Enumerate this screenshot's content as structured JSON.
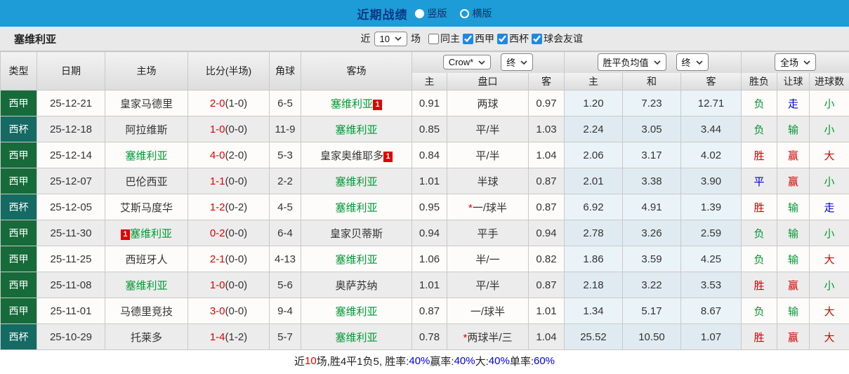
{
  "topbar": {
    "title": "近期战绩",
    "radio_vertical": "竖版",
    "radio_horizontal": "横版",
    "selected": "竖版",
    "bar_color": "#1e9cd7"
  },
  "filterbar": {
    "team": "塞维利亚",
    "near_label": "近",
    "near_value": "10",
    "games_label": "场",
    "checkboxes": [
      {
        "label": "同主",
        "checked": false
      },
      {
        "label": "西甲",
        "checked": true
      },
      {
        "label": "西杯",
        "checked": true
      },
      {
        "label": "球会友谊",
        "checked": true
      }
    ]
  },
  "table": {
    "col_headers": [
      "类型",
      "日期",
      "主场",
      "比分(半场)",
      "角球",
      "客场"
    ],
    "dropdowns": {
      "odds_source": "Crow*",
      "odds_final": "终",
      "avg_source": "胜平负均值",
      "avg_final": "终",
      "scope": "全场"
    },
    "subheaders": [
      "主",
      "盘口",
      "客",
      "主",
      "和",
      "客",
      "胜负",
      "让球",
      "进球数"
    ],
    "league_colors": {
      "西甲": "#176b3a",
      "西杯": "#156a63"
    },
    "rows": [
      {
        "league": "西甲",
        "type": "liga",
        "date": "25-12-21",
        "home": {
          "name": "皇家马德里",
          "green": false
        },
        "score": {
          "ft": "2-0",
          "ht": "(1-0)"
        },
        "corners": "6-5",
        "away": {
          "name": "塞维利亚",
          "green": true,
          "badge_after": "1"
        },
        "odds_home": "0.91",
        "handicap": {
          "star": false,
          "text": "两球"
        },
        "odds_away": "0.97",
        "avg_home": "1.20",
        "avg_draw": "7.23",
        "avg_away": "12.71",
        "result": {
          "t": "负",
          "c": "green"
        },
        "handicap_result": {
          "t": "走",
          "c": "blue"
        },
        "goals": {
          "t": "小",
          "c": "green"
        }
      },
      {
        "league": "西杯",
        "type": "cup",
        "date": "25-12-18",
        "home": {
          "name": "阿拉维斯",
          "green": false
        },
        "score": {
          "ft": "1-0",
          "ht": "(0-0)"
        },
        "corners": "11-9",
        "away": {
          "name": "塞维利亚",
          "green": true
        },
        "odds_home": "0.85",
        "handicap": {
          "star": false,
          "text": "平/半"
        },
        "odds_away": "1.03",
        "avg_home": "2.24",
        "avg_draw": "3.05",
        "avg_away": "3.44",
        "result": {
          "t": "负",
          "c": "green"
        },
        "handicap_result": {
          "t": "输",
          "c": "green"
        },
        "goals": {
          "t": "小",
          "c": "green"
        }
      },
      {
        "league": "西甲",
        "type": "liga",
        "date": "25-12-14",
        "home": {
          "name": "塞维利亚",
          "green": true
        },
        "score": {
          "ft": "4-0",
          "ht": "(2-0)"
        },
        "corners": "5-3",
        "away": {
          "name": "皇家奥维耶多",
          "green": false,
          "badge_after": "1"
        },
        "odds_home": "0.84",
        "handicap": {
          "star": false,
          "text": "平/半"
        },
        "odds_away": "1.04",
        "avg_home": "2.06",
        "avg_draw": "3.17",
        "avg_away": "4.02",
        "result": {
          "t": "胜",
          "c": "red"
        },
        "handicap_result": {
          "t": "赢",
          "c": "red"
        },
        "goals": {
          "t": "大",
          "c": "red"
        }
      },
      {
        "league": "西甲",
        "type": "liga",
        "date": "25-12-07",
        "home": {
          "name": "巴伦西亚",
          "green": false
        },
        "score": {
          "ft": "1-1",
          "ht": "(0-0)"
        },
        "corners": "2-2",
        "away": {
          "name": "塞维利亚",
          "green": true
        },
        "odds_home": "1.01",
        "handicap": {
          "star": false,
          "text": "半球"
        },
        "odds_away": "0.87",
        "avg_home": "2.01",
        "avg_draw": "3.38",
        "avg_away": "3.90",
        "result": {
          "t": "平",
          "c": "blue"
        },
        "handicap_result": {
          "t": "赢",
          "c": "red"
        },
        "goals": {
          "t": "小",
          "c": "green"
        }
      },
      {
        "league": "西杯",
        "type": "cup",
        "date": "25-12-05",
        "home": {
          "name": "艾斯马度华",
          "green": false
        },
        "score": {
          "ft": "1-2",
          "ht": "(0-2)"
        },
        "corners": "4-5",
        "away": {
          "name": "塞维利亚",
          "green": true
        },
        "odds_home": "0.95",
        "handicap": {
          "star": true,
          "text": "一/球半"
        },
        "odds_away": "0.87",
        "avg_home": "6.92",
        "avg_draw": "4.91",
        "avg_away": "1.39",
        "result": {
          "t": "胜",
          "c": "red"
        },
        "handicap_result": {
          "t": "输",
          "c": "green"
        },
        "goals": {
          "t": "走",
          "c": "blue"
        }
      },
      {
        "league": "西甲",
        "type": "liga",
        "date": "25-11-30",
        "home": {
          "name": "塞维利亚",
          "green": true,
          "badge_before": "1"
        },
        "score": {
          "ft": "0-2",
          "ht": "(0-0)"
        },
        "corners": "6-4",
        "away": {
          "name": "皇家贝蒂斯",
          "green": false
        },
        "odds_home": "0.94",
        "handicap": {
          "star": false,
          "text": "平手"
        },
        "odds_away": "0.94",
        "avg_home": "2.78",
        "avg_draw": "3.26",
        "avg_away": "2.59",
        "result": {
          "t": "负",
          "c": "green"
        },
        "handicap_result": {
          "t": "输",
          "c": "green"
        },
        "goals": {
          "t": "小",
          "c": "green"
        }
      },
      {
        "league": "西甲",
        "type": "liga",
        "date": "25-11-25",
        "home": {
          "name": "西班牙人",
          "green": false
        },
        "score": {
          "ft": "2-1",
          "ht": "(0-0)"
        },
        "corners": "4-13",
        "away": {
          "name": "塞维利亚",
          "green": true
        },
        "odds_home": "1.06",
        "handicap": {
          "star": false,
          "text": "半/一"
        },
        "odds_away": "0.82",
        "avg_home": "1.86",
        "avg_draw": "3.59",
        "avg_away": "4.25",
        "result": {
          "t": "负",
          "c": "green"
        },
        "handicap_result": {
          "t": "输",
          "c": "green"
        },
        "goals": {
          "t": "大",
          "c": "red"
        }
      },
      {
        "league": "西甲",
        "type": "liga",
        "date": "25-11-08",
        "home": {
          "name": "塞维利亚",
          "green": true
        },
        "score": {
          "ft": "1-0",
          "ht": "(0-0)"
        },
        "corners": "5-6",
        "away": {
          "name": "奥萨苏纳",
          "green": false
        },
        "odds_home": "1.01",
        "handicap": {
          "star": false,
          "text": "平/半"
        },
        "odds_away": "0.87",
        "avg_home": "2.18",
        "avg_draw": "3.22",
        "avg_away": "3.53",
        "result": {
          "t": "胜",
          "c": "red"
        },
        "handicap_result": {
          "t": "赢",
          "c": "red"
        },
        "goals": {
          "t": "小",
          "c": "green"
        }
      },
      {
        "league": "西甲",
        "type": "liga",
        "date": "25-11-01",
        "home": {
          "name": "马德里竞技",
          "green": false
        },
        "score": {
          "ft": "3-0",
          "ht": "(0-0)"
        },
        "corners": "9-4",
        "away": {
          "name": "塞维利亚",
          "green": true
        },
        "odds_home": "0.87",
        "handicap": {
          "star": false,
          "text": "一/球半"
        },
        "odds_away": "1.01",
        "avg_home": "1.34",
        "avg_draw": "5.17",
        "avg_away": "8.67",
        "result": {
          "t": "负",
          "c": "green"
        },
        "handicap_result": {
          "t": "输",
          "c": "green"
        },
        "goals": {
          "t": "大",
          "c": "red"
        }
      },
      {
        "league": "西杯",
        "type": "cup",
        "date": "25-10-29",
        "home": {
          "name": "托莱多",
          "green": false
        },
        "score": {
          "ft": "1-4",
          "ht": "(1-2)"
        },
        "corners": "5-7",
        "away": {
          "name": "塞维利亚",
          "green": true
        },
        "odds_home": "0.78",
        "handicap": {
          "star": true,
          "text": "两球半/三"
        },
        "odds_away": "1.04",
        "avg_home": "25.52",
        "avg_draw": "10.50",
        "avg_away": "1.07",
        "result": {
          "t": "胜",
          "c": "red"
        },
        "handicap_result": {
          "t": "赢",
          "c": "red"
        },
        "goals": {
          "t": "大",
          "c": "red"
        }
      }
    ]
  },
  "summary": {
    "parts": [
      {
        "t": "近",
        "c": "black"
      },
      {
        "t": "10",
        "c": "red"
      },
      {
        "t": "场,胜4平1负5, 胜率:",
        "c": "black"
      },
      {
        "t": "40%",
        "c": "blue"
      },
      {
        "t": " 赢率:",
        "c": "black"
      },
      {
        "t": "40%",
        "c": "blue"
      },
      {
        "t": " 大:",
        "c": "black"
      },
      {
        "t": "40%",
        "c": "blue"
      },
      {
        "t": " 单率:",
        "c": "black"
      },
      {
        "t": "60%",
        "c": "blue"
      }
    ]
  }
}
